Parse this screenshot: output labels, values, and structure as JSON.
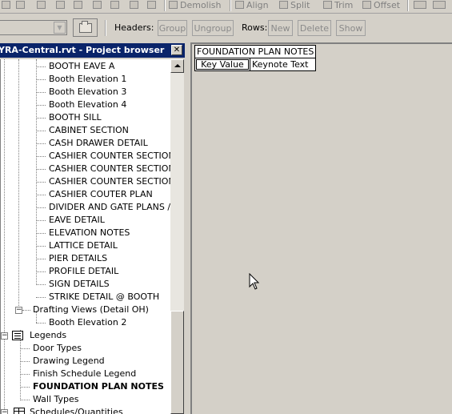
{
  "toolbar_top": {
    "items": [
      {
        "label": "Demolish",
        "icon": "demolish-icon"
      },
      {
        "label": "Align",
        "icon": "align-icon"
      },
      {
        "label": "Split",
        "icon": "split-icon"
      },
      {
        "label": "Trim",
        "icon": "trim-icon"
      },
      {
        "label": "Offset",
        "icon": "offset-icon"
      }
    ]
  },
  "toolbar_schedule": {
    "headers_label": "Headers:",
    "group_label": "Group",
    "ungroup_label": "Ungroup",
    "rows_label": "Rows:",
    "new_label": "New",
    "delete_label": "Delete",
    "show_label": "Show"
  },
  "project_browser": {
    "title": "YRA-Central.rvt - Project browser",
    "items": [
      {
        "label": "BOOTH EAVE A"
      },
      {
        "label": "Booth Elevation 1"
      },
      {
        "label": "Booth Elevation 3"
      },
      {
        "label": "Booth Elevation 4"
      },
      {
        "label": "BOOTH SILL"
      },
      {
        "label": "CABINET SECTION"
      },
      {
        "label": "CASH DRAWER DETAIL"
      },
      {
        "label": "CASHIER COUNTER SECTION"
      },
      {
        "label": "CASHIER COUNTER SECTION"
      },
      {
        "label": "CASHIER COUNTER SECTION"
      },
      {
        "label": "CASHIER COUTER PLAN"
      },
      {
        "label": "DIVIDER AND GATE PLANS / ELEVATIONS"
      },
      {
        "label": "EAVE DETAIL"
      },
      {
        "label": "ELEVATION NOTES"
      },
      {
        "label": "LATTICE DETAIL"
      },
      {
        "label": "PIER DETAILS"
      },
      {
        "label": "PROFILE DETAIL"
      },
      {
        "label": "SIGN DETAILS"
      },
      {
        "label": "STRIKE DETAIL @ BOOTH"
      },
      {
        "label": "Drafting Views (Detail OH)"
      },
      {
        "label": "Booth Elevation 2"
      },
      {
        "label": "Legends"
      },
      {
        "label": "Door Types"
      },
      {
        "label": "Drawing Legend"
      },
      {
        "label": "Finish Schedule Legend"
      },
      {
        "label": "FOUNDATION PLAN NOTES"
      },
      {
        "label": "Wall Types"
      },
      {
        "label": "Schedules/Quantities"
      }
    ]
  },
  "schedule": {
    "title": "FOUNDATION PLAN NOTES",
    "columns": [
      "Key Value",
      "Keynote Text"
    ]
  }
}
